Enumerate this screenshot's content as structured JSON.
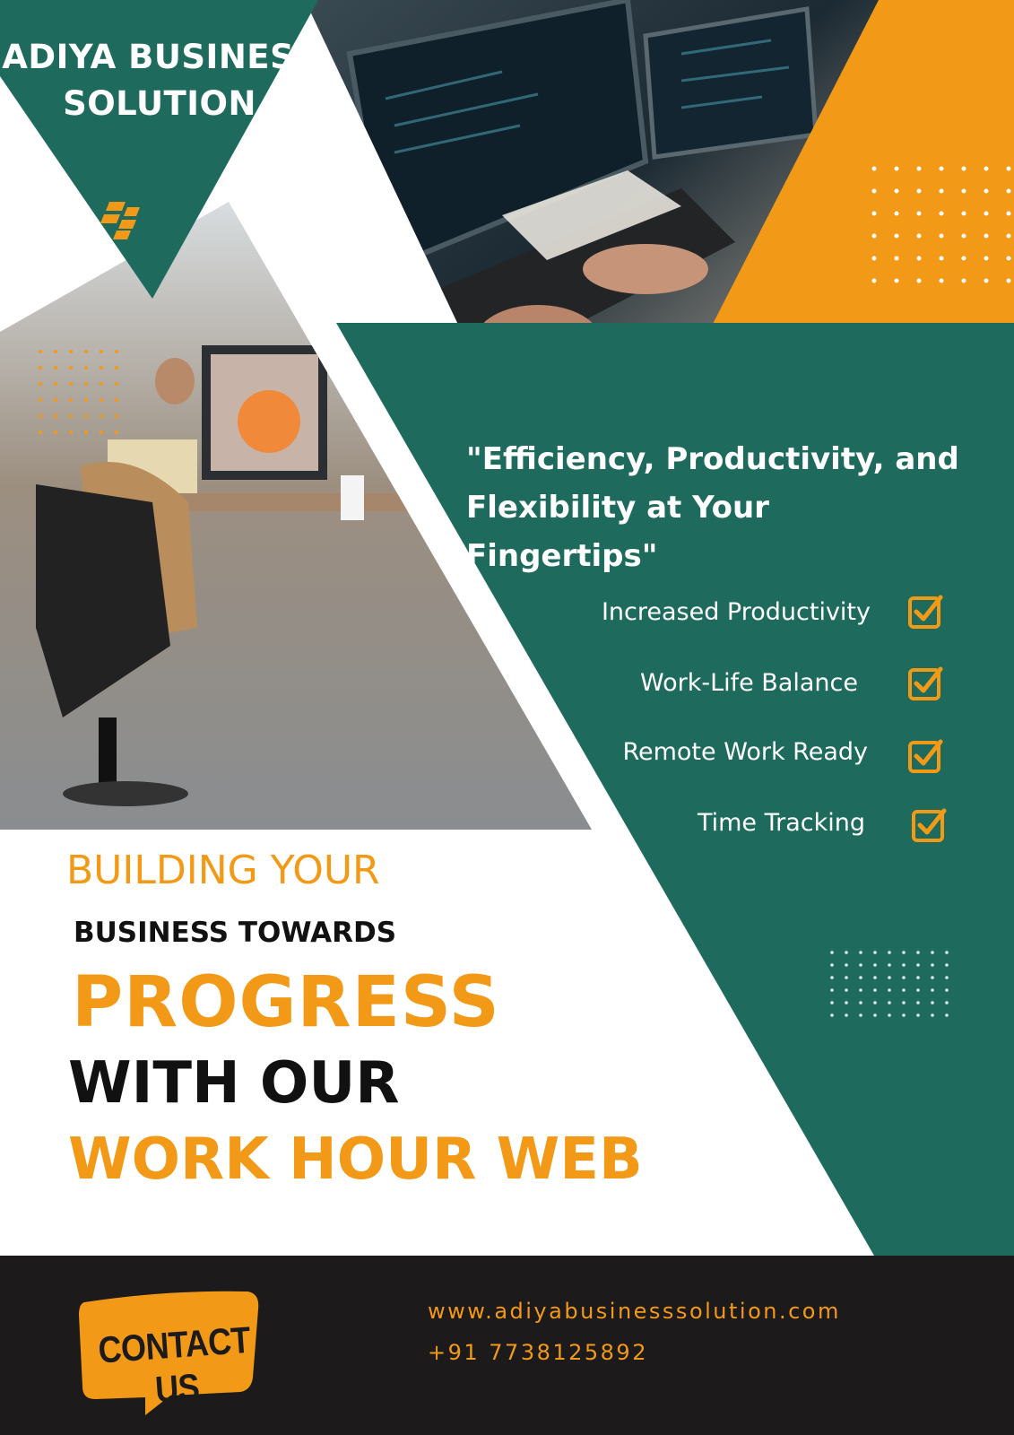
{
  "colors": {
    "green": "#1e6b5e",
    "orange": "#f29a17",
    "dark": "#1c1a1b",
    "white": "#ffffff"
  },
  "brand": {
    "name_line1": "ADIYA BUSINESS",
    "name_line2": "SOLUTION",
    "logo_icon": "stacked-blocks-icon"
  },
  "tagline": {
    "line1": "\"Efficiency, Productivity, and",
    "line2": "Flexibility at Your Fingertips\""
  },
  "features": [
    {
      "label": "Increased Productivity",
      "icon": "checkbox-checked-icon"
    },
    {
      "label": "Work-Life Balance",
      "icon": "checkbox-checked-icon"
    },
    {
      "label": "Remote Work Ready",
      "icon": "checkbox-checked-icon"
    },
    {
      "label": "Time Tracking",
      "icon": "checkbox-checked-icon"
    }
  ],
  "headline": {
    "line1": "BUILDING YOUR",
    "line2": "BUSINESS TOWARDS",
    "line3": "PROGRESS",
    "line4": "WITH OUR",
    "line5": "WORK HOUR WEB"
  },
  "footer": {
    "contact_label": "CONTACT US",
    "website": "www.adiyabusinesssolution.com",
    "phone": "+91 7738125892"
  },
  "photos": {
    "top_photo": "hands typing on keyboard with code on monitors",
    "left_photo": "office workers at desks with computers"
  }
}
